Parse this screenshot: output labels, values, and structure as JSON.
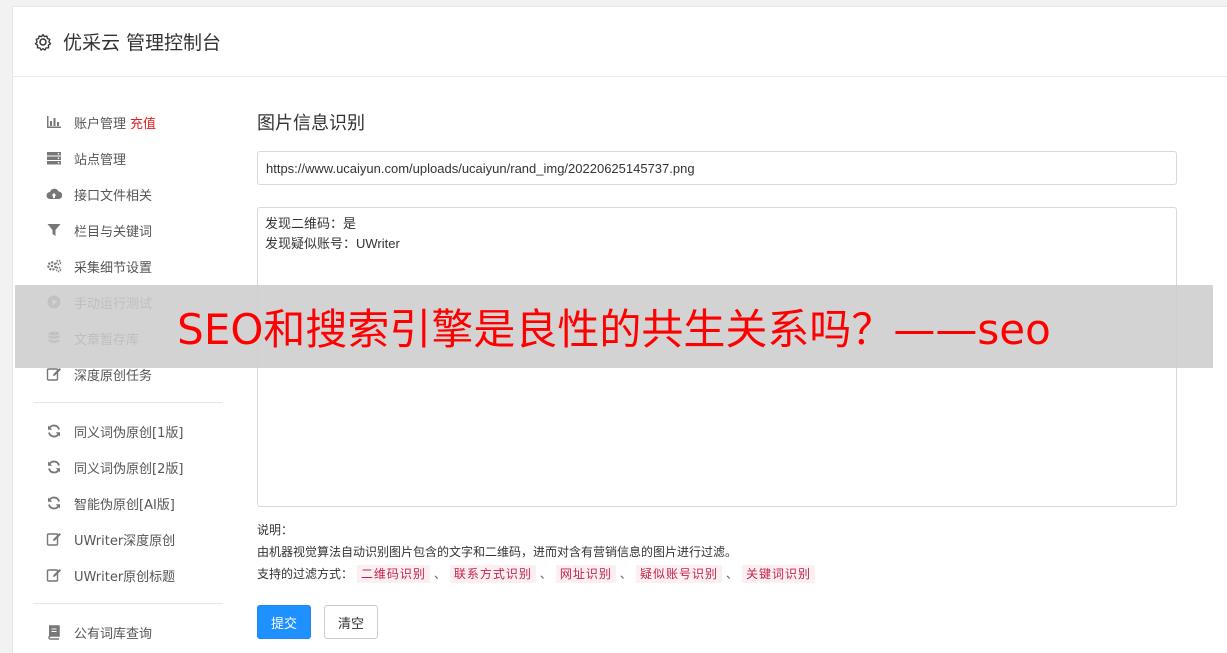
{
  "header": {
    "icon": "gear-icon",
    "title": "优采云 管理控制台"
  },
  "sidebar": {
    "groups": [
      [
        {
          "icon": "bar-chart-icon",
          "label": "账户管理",
          "badge": "充值"
        },
        {
          "icon": "server-icon",
          "label": "站点管理"
        },
        {
          "icon": "cloud-upload-icon",
          "label": "接口文件相关"
        },
        {
          "icon": "filter-icon",
          "label": "栏目与关键词"
        },
        {
          "icon": "gears-icon",
          "label": "采集细节设置"
        },
        {
          "icon": "play-circle-icon",
          "label": "手动运行测试"
        },
        {
          "icon": "database-icon",
          "label": "文章暂存库"
        },
        {
          "icon": "edit-icon",
          "label": "深度原创任务"
        }
      ],
      [
        {
          "icon": "refresh-icon",
          "label": "同义词伪原创[1版]"
        },
        {
          "icon": "refresh-icon",
          "label": "同义词伪原创[2版]"
        },
        {
          "icon": "refresh-icon",
          "label": "智能伪原创[AI版]"
        },
        {
          "icon": "edit-icon",
          "label": "UWriter深度原创"
        },
        {
          "icon": "edit-icon",
          "label": "UWriter原创标题"
        }
      ],
      [
        {
          "icon": "book-icon",
          "label": "公有词库查询"
        }
      ]
    ]
  },
  "main": {
    "title": "图片信息识别",
    "url_value": "https://www.ucaiyun.com/uploads/ucaiyun/rand_img/20220625145737.png",
    "result_lines": [
      "发现二维码：是",
      "发现疑似账号：UWriter"
    ],
    "notes_label": "说明：",
    "notes_desc": "由机器视觉算法自动识别图片包含的文字和二维码，进而对含有营销信息的图片进行过滤。",
    "filters_label": "支持的过滤方式：",
    "filters": [
      "二维码识别",
      "联系方式识别",
      "网址识别",
      "疑似账号识别",
      "关键词识别"
    ],
    "separator": "、",
    "submit_label": "提交",
    "clear_label": "清空"
  },
  "overlay": {
    "text": "SEO和搜索引擎是良性的共生关系吗？——seo"
  },
  "colors": {
    "primary": "#1e90ff",
    "badge": "#e02020",
    "tag_text": "#c3234b",
    "tag_bg": "#fbeff2",
    "overlay_text": "#ff0000"
  }
}
